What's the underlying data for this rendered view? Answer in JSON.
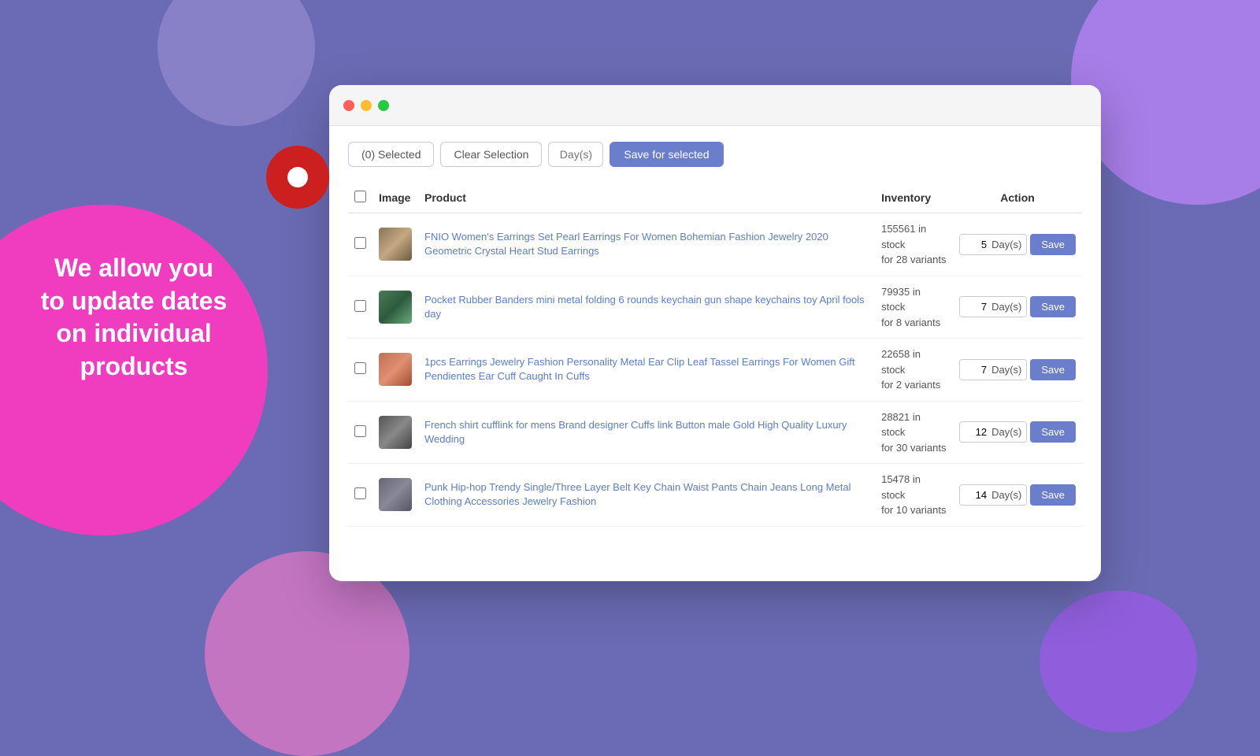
{
  "background": {
    "color": "#6b6bb5"
  },
  "left_text": {
    "line1": "We allow you",
    "line2": "to update dates",
    "line3": "on individual",
    "line4": "products"
  },
  "toolbar": {
    "selected_label": "(0) Selected",
    "clear_label": "Clear Selection",
    "days_placeholder": "Day(s)",
    "save_selected_label": "Save for selected"
  },
  "table": {
    "headers": {
      "image": "Image",
      "product": "Product",
      "inventory": "Inventory",
      "action": "Action"
    },
    "rows": [
      {
        "id": 1,
        "product_name": "FNIO Women's Earrings Set Pearl Earrings For Women Bohemian Fashion Jewelry 2020 Geometric Crystal Heart Stud Earrings",
        "inventory_count": "155561 in stock",
        "inventory_variants": "for 28 variants",
        "days_value": "5",
        "img_class": "img-box-1"
      },
      {
        "id": 2,
        "product_name": "Pocket Rubber Banders mini metal folding 6 rounds keychain gun shape keychains toy April fools day",
        "inventory_count": "79935 in stock",
        "inventory_variants": "for 8 variants",
        "days_value": "7",
        "img_class": "img-box-2"
      },
      {
        "id": 3,
        "product_name": "1pcs Earrings Jewelry Fashion Personality Metal Ear Clip Leaf Tassel Earrings For Women Gift Pendientes Ear Cuff Caught In Cuffs",
        "inventory_count": "22658 in stock",
        "inventory_variants": "for 2 variants",
        "days_value": "7",
        "img_class": "img-box-3"
      },
      {
        "id": 4,
        "product_name": "French shirt cufflink for mens Brand designer Cuffs link Button male Gold High Quality Luxury Wedding",
        "inventory_count": "28821 in stock",
        "inventory_variants": "for 30 variants",
        "days_value": "12",
        "img_class": "img-box-4"
      },
      {
        "id": 5,
        "product_name": "Punk Hip-hop Trendy Single/Three Layer Belt Key Chain Waist Pants Chain Jeans Long Metal Clothing Accessories Jewelry Fashion",
        "inventory_count": "15478 in stock",
        "inventory_variants": "for 10 variants",
        "days_value": "14",
        "img_class": "img-box-5"
      }
    ]
  },
  "buttons": {
    "save_label": "Save"
  }
}
